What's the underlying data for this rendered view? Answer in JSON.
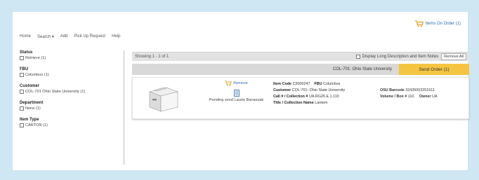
{
  "header": {
    "items_on_order": "Items On Order (1)"
  },
  "nav": [
    "Home",
    "Search ▾",
    "Add",
    "Pick Up Request",
    "Help"
  ],
  "filters": [
    {
      "title": "Status",
      "option": "Retrieve (1)"
    },
    {
      "title": "FBU",
      "option": "Columbus (1)"
    },
    {
      "title": "Customer",
      "option": "COL-701 Ohio State University (1)"
    },
    {
      "title": "Department",
      "option": "None (1)"
    },
    {
      "title": "Item Type",
      "option": "CARTON (1)"
    }
  ],
  "results": {
    "showing": "Showing 1 - 1 of 1",
    "display_long": "Display Long Description and Item Notes",
    "remove_all": "Remove All",
    "group_label": "COL-701: Ohio State University",
    "send_order": "Send Order (1)"
  },
  "item": {
    "remove_label": "Remove",
    "status": "Pending send Laurie Banaszak",
    "item_code_label": "Item Code",
    "item_code": "C5000247",
    "fbu_label": "FBU",
    "fbu": "Columbus",
    "customer_label": "Customer",
    "customer": "COL-701: Ohio State University",
    "call_label": "Call # / Collection #",
    "call": "UA.RG26.E.1.110",
    "title_label": "Title / Collection Name",
    "title": "Lantern",
    "osu_barcode_label": "OSU Barcode",
    "osu_barcode": "32435003251611",
    "volume_label": "Volume / Box #",
    "volume": "110",
    "owner_label": "Owner",
    "owner": "UA"
  },
  "colors": {
    "background": "#cfe6f3",
    "accent_link": "#2a6db5",
    "send_order": "#f5c542"
  }
}
